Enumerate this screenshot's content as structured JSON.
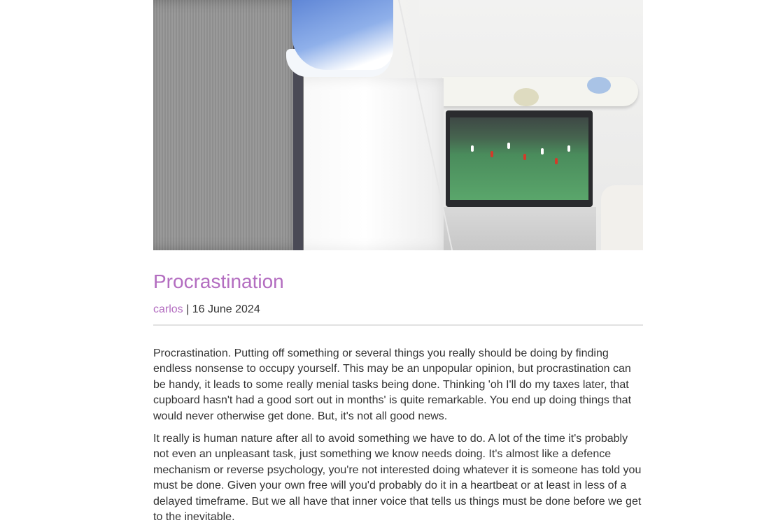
{
  "post": {
    "hero_image": "ironing-while-watching-football-photo",
    "title": "Procrastination",
    "author": "carlos",
    "separator": "|",
    "date": "16 June 2024",
    "paragraphs": [
      "Procrastination. Putting off something or several things you really should be doing by finding endless nonsense to occupy yourself. This may be an unpopular opinion, but procrastination can be handy, it leads to some really menial tasks being done. Thinking 'oh I'll do my taxes later, that cupboard hasn't had a good sort out in months' is quite remarkable. You end up doing things that would never otherwise get done. But, it's not all good news.",
      "It really is human nature after all to avoid something we have to do. A lot of the time it's probably not even an unpleasant task, just something we know needs doing. It's almost like a defence mechanism or reverse psychology, you're not interested doing whatever it is someone has told you must be done. Given your own free will you'd probably do it in a heartbeat or at least in less of a delayed timeframe. But we all have that inner voice that tells us things must be done before we get to the inevitable."
    ]
  },
  "colors": {
    "accent": "#b36dc0",
    "text": "#333333",
    "divider": "#e2e2e2"
  }
}
